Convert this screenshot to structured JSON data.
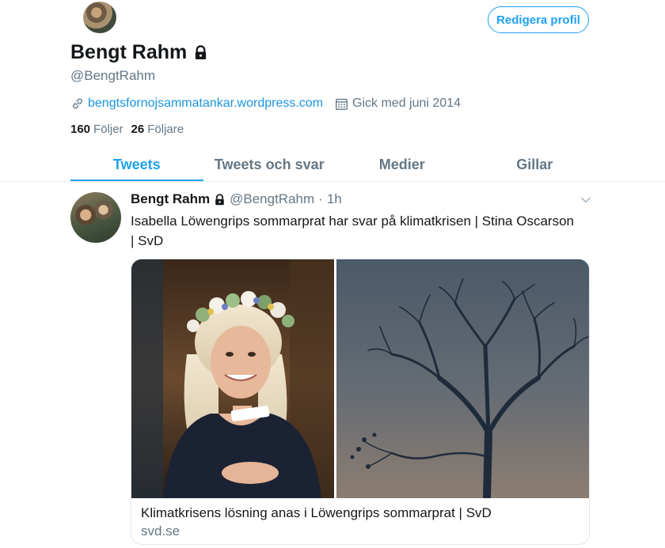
{
  "profile": {
    "display_name": "Bengt Rahm",
    "handle": "@BengtRahm",
    "edit_button": "Redigera profil",
    "website": "bengtsfornojsammatankar.wordpress.com",
    "joined": "Gick med juni 2014",
    "following_count": "160",
    "following_label": "Följer",
    "followers_count": "26",
    "followers_label": "Följare"
  },
  "tabs": [
    {
      "label": "Tweets",
      "active": true
    },
    {
      "label": "Tweets och svar",
      "active": false
    },
    {
      "label": "Medier",
      "active": false
    },
    {
      "label": "Gillar",
      "active": false
    }
  ],
  "tweet": {
    "author_name": "Bengt Rahm",
    "author_handle": "@BengtRahm",
    "separator": "·",
    "time": "1h",
    "text": "Isabella Löwengrips sommarprat har svar på klimatkrisen | Stina Oscarson | SvD",
    "card": {
      "title": "Klimatkrisens lösning anas i Löwengrips sommarprat | SvD",
      "domain": "svd.se"
    }
  },
  "icons": {
    "lock": "lock-icon",
    "link": "link-icon",
    "calendar": "calendar-icon",
    "caret": "chevron-down-icon"
  },
  "colors": {
    "accent": "#1da1f2",
    "link": "#1b95e0",
    "muted": "#657786",
    "text": "#14171a"
  }
}
